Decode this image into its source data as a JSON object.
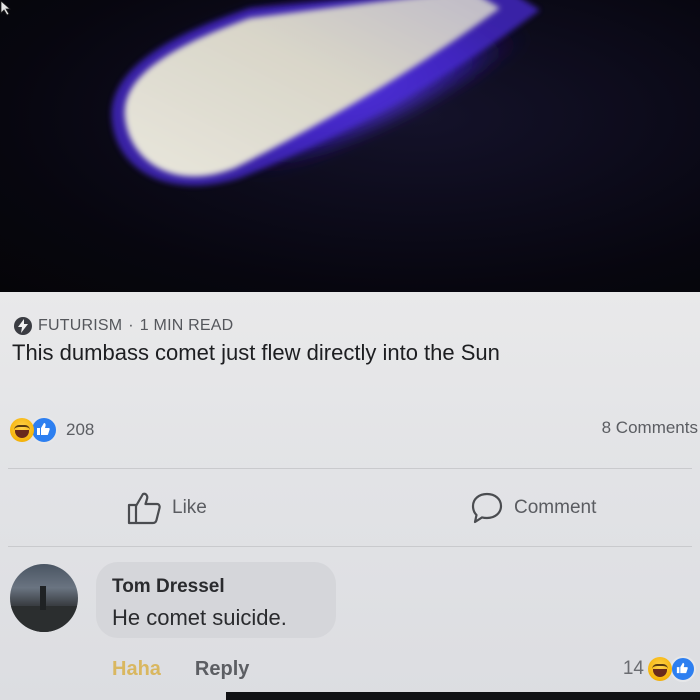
{
  "post": {
    "source": "FUTURISM",
    "separator": "·",
    "read_time": "1 MIN READ",
    "headline": "This dumbass comet just flew directly into the Sun",
    "reaction_count": "208",
    "comments_count": "8 Comments"
  },
  "actions": {
    "like_label": "Like",
    "comment_label": "Comment"
  },
  "comment": {
    "author": "Tom Dressel",
    "text": "He comet suicide.",
    "haha_label": "Haha",
    "reply_label": "Reply",
    "reaction_count": "14"
  },
  "icons": {
    "source": "lightning-bolt-icon",
    "reaction_haha": "laughing-emoji-icon",
    "reaction_like": "thumbs-up-icon",
    "like_action": "thumbs-up-outline-icon",
    "comment_action": "speech-bubble-icon",
    "cursor": "mouse-pointer-icon"
  },
  "colors": {
    "like_blue": "#2d7ff0",
    "haha_yellow": "#f6b40a",
    "haha_label": "#d9b760"
  }
}
